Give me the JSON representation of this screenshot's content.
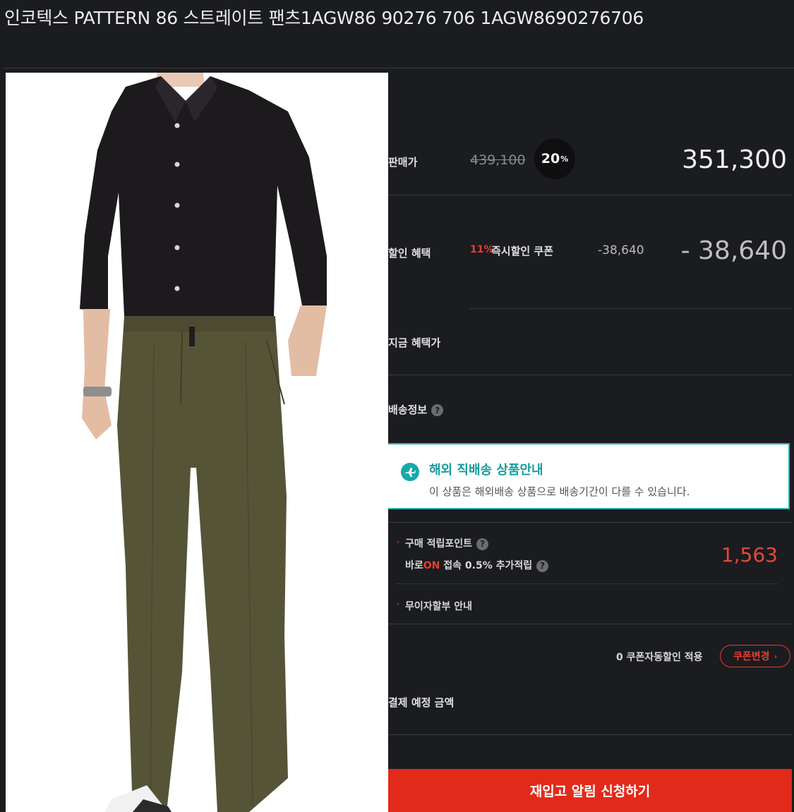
{
  "product": {
    "title": "인코텍스 PATTERN 86 스트레이트 팬츠1AGW86 90276 706 1AGW8690276706"
  },
  "price": {
    "label": "판매가",
    "original": "439,100",
    "discount_value": "20",
    "discount_unit": "%",
    "sale": "351,300"
  },
  "benefit": {
    "label": "할인 혜택",
    "coupon_rate": "11%",
    "coupon_name": "즉시할인 쿠폰",
    "coupon_amount": "-38,640",
    "total": "- 38,640"
  },
  "current_benefit_price": {
    "label": "지금 혜택가"
  },
  "shipping": {
    "label": "배송정보",
    "help": "?",
    "notice_title": "해외 직배송 상품안내",
    "notice_desc": "이 상품은 해외배송 상품으로 배송기간이 다를 수 있습니다."
  },
  "points": {
    "label": "구매 적립포인트",
    "help": "?",
    "barun_prefix": "바로",
    "barun_on": "ON",
    "barun_suffix": " 접속 0.5% 추가적립",
    "value": "1,563"
  },
  "installment": {
    "label": "무이자할부 안내"
  },
  "coupon": {
    "auto_apply": "0 쿠폰자동할인 적용",
    "change_button": "쿠폰변경"
  },
  "payment": {
    "label": "결제 예정 금액"
  },
  "actions": {
    "restock_button": "재입고 알림 신청하기"
  },
  "colors": {
    "background": "#1b1c20",
    "accent_red": "#e22a1a",
    "notice_teal": "#19a8a8"
  }
}
